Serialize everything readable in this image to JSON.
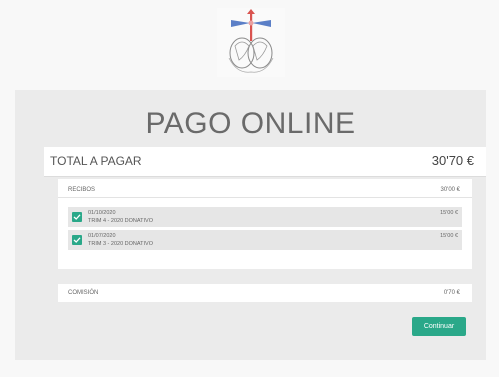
{
  "header": {
    "logo_icon": "emblem-logo"
  },
  "payment": {
    "title": "PAGO ONLINE",
    "total_label": "TOTAL A PAGAR",
    "total_amount": "30'70 €",
    "receipts": {
      "label": "RECIBOS",
      "amount": "30'00 €",
      "items": [
        {
          "date": "01/10/2020",
          "description": "TRIM 4 - 2020 DONATIVO",
          "amount": "15'00 €",
          "checked": true
        },
        {
          "date": "01/07/2020",
          "description": "TRIM 3 - 2020 DONATIVO",
          "amount": "15'00 €",
          "checked": true
        }
      ]
    },
    "fee": {
      "label": "COMISIÓN",
      "amount": "0'70 €"
    },
    "continue_label": "Continuar"
  },
  "colors": {
    "accent": "#2aa889",
    "panel": "#ebebeb",
    "background": "#f8f8f8"
  }
}
